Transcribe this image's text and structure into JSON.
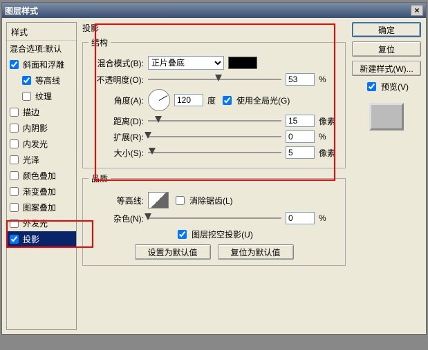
{
  "title": "图层样式",
  "styles_header": "样式",
  "blend_options": "混合选项:默认",
  "effects": [
    {
      "label": "斜面和浮雕",
      "checked": true,
      "indent": false
    },
    {
      "label": "等高线",
      "checked": true,
      "indent": true
    },
    {
      "label": "纹理",
      "checked": false,
      "indent": true
    },
    {
      "label": "描边",
      "checked": false,
      "indent": false
    },
    {
      "label": "内阴影",
      "checked": false,
      "indent": false
    },
    {
      "label": "内发光",
      "checked": false,
      "indent": false
    },
    {
      "label": "光泽",
      "checked": false,
      "indent": false
    },
    {
      "label": "颜色叠加",
      "checked": false,
      "indent": false
    },
    {
      "label": "渐变叠加",
      "checked": false,
      "indent": false
    },
    {
      "label": "图案叠加",
      "checked": false,
      "indent": false
    },
    {
      "label": "外发光",
      "checked": false,
      "indent": false
    },
    {
      "label": "投影",
      "checked": true,
      "indent": false,
      "selected": true
    }
  ],
  "panel_heading": "投影",
  "group_structure": "结构",
  "labels": {
    "blend_mode": "混合模式(B):",
    "opacity": "不透明度(O):",
    "angle": "角度(A):",
    "global_light": "使用全局光(G)",
    "distance": "距离(D):",
    "spread": "扩展(R):",
    "size": "大小(S):",
    "degree": "度",
    "px": "像素",
    "pct": "%"
  },
  "values": {
    "blend_mode": "正片叠底",
    "opacity": "53",
    "angle": "120",
    "global_light": true,
    "distance": "15",
    "spread": "0",
    "size": "5"
  },
  "group_quality": "品质",
  "quality": {
    "contour": "等高线:",
    "antialias": "消除锯齿(L)",
    "antialias_checked": false,
    "noise": "杂色(N):",
    "noise_val": "0",
    "knockout": "图层挖空投影(U)",
    "knockout_checked": true
  },
  "buttons": {
    "make_default": "设置为默认值",
    "reset_default": "复位为默认值"
  },
  "rightbtns": {
    "ok": "确定",
    "cancel": "复位",
    "newstyle": "新建样式(W)...",
    "preview": "预览(V)",
    "preview_checked": true
  }
}
